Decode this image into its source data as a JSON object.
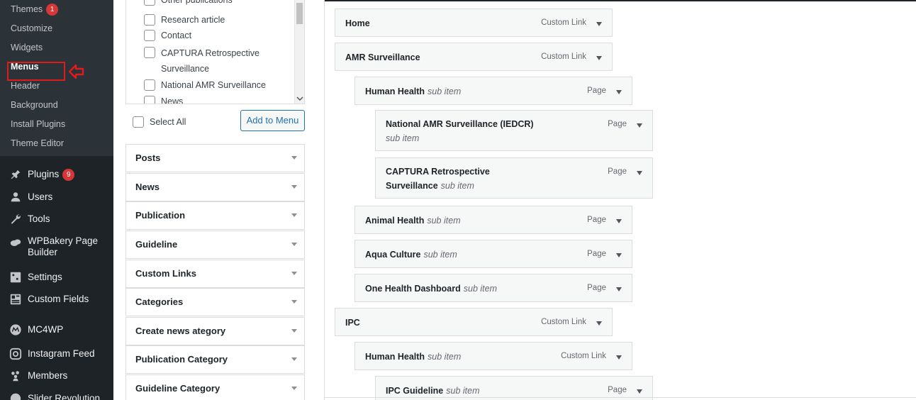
{
  "sidebar": {
    "submenu": [
      {
        "label": "Themes",
        "badge": "1"
      },
      {
        "label": "Customize"
      },
      {
        "label": "Widgets"
      },
      {
        "label": "Menus",
        "current": true
      },
      {
        "label": "Header"
      },
      {
        "label": "Background"
      },
      {
        "label": "Install Plugins"
      },
      {
        "label": "Theme Editor"
      }
    ],
    "main": [
      {
        "label": "Plugins",
        "icon": "plugin-icon",
        "badge": "9"
      },
      {
        "label": "Users",
        "icon": "users-icon"
      },
      {
        "label": "Tools",
        "icon": "wrench-icon"
      },
      {
        "label": "WPBakery Page Builder",
        "icon": "cloud-icon"
      },
      {
        "label": "Settings",
        "icon": "settings-icon"
      },
      {
        "label": "Custom Fields",
        "icon": "custom-fields-icon"
      },
      {
        "label": "MC4WP",
        "icon": "mc4wp-icon"
      },
      {
        "label": "Instagram Feed",
        "icon": "instagram-icon"
      },
      {
        "label": "Members",
        "icon": "members-icon"
      },
      {
        "label": "Slider Revolution",
        "icon": "slider-icon"
      }
    ],
    "highlight_color": "#e01b1b"
  },
  "panel": {
    "checkbox_items": [
      "Other publications",
      "Research article",
      "Contact",
      "CAPTURA Retrospective Surveillance",
      "National AMR Surveillance",
      "News"
    ],
    "select_all": "Select All",
    "add_button": "Add to Menu",
    "accordions": [
      "Posts",
      "News",
      "Publication",
      "Guideline",
      "Custom Links",
      "Categories",
      "Create news ategory",
      "Publication Category",
      "Guideline Category"
    ]
  },
  "menu_items": [
    {
      "title": "Home",
      "sub": "",
      "type": "Custom Link"
    },
    {
      "title": "AMR Surveillance",
      "sub": "",
      "type": "Custom Link"
    },
    {
      "title": "Human Health",
      "sub": "sub item",
      "type": "Page"
    },
    {
      "title": "National AMR Surveillance (IEDCR)",
      "sub": "sub item",
      "type": "Page"
    },
    {
      "title": "CAPTURA Retrospective Surveillance",
      "sub": "sub item",
      "type": "Page"
    },
    {
      "title": "Animal Health",
      "sub": "sub item",
      "type": "Page"
    },
    {
      "title": "Aqua Culture",
      "sub": "sub item",
      "type": "Page"
    },
    {
      "title": "One Health Dashboard",
      "sub": "sub item",
      "type": "Page"
    },
    {
      "title": "IPC",
      "sub": "",
      "type": "Custom Link"
    },
    {
      "title": "Human Health",
      "sub": "sub item",
      "type": "Custom Link"
    },
    {
      "title": "IPC Guideline",
      "sub": "sub item",
      "type": "Page"
    }
  ],
  "colors": {
    "sidebar_bg": "#1d2327",
    "submenu_bg": "#2c3338",
    "accent": "#2271b1",
    "badge": "#d63638"
  }
}
